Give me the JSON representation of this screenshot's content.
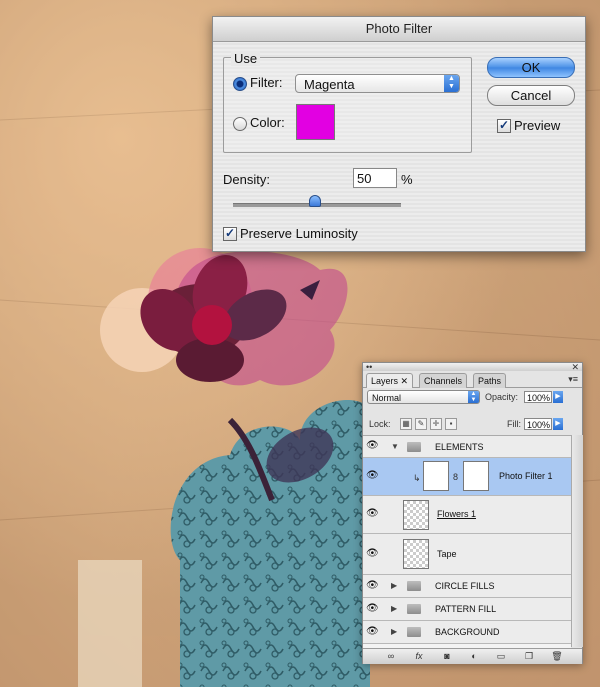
{
  "dialog": {
    "title": "Photo Filter",
    "use_group_label": "Use",
    "filter_label": "Filter:",
    "filter_value": "Magenta",
    "color_label": "Color:",
    "color_swatch": "#e200e2",
    "density_label": "Density:",
    "density_value": "50",
    "density_unit": "%",
    "density_level": 0.5,
    "preserve_luminosity_label": "Preserve Luminosity",
    "preserve_luminosity_checked": true,
    "ok_label": "OK",
    "cancel_label": "Cancel",
    "preview_label": "Preview",
    "preview_checked": true,
    "selected_mode": "filter"
  },
  "layers_panel": {
    "tabs": [
      {
        "label": "Layers",
        "close": "✕",
        "active": true
      },
      {
        "label": "Channels",
        "active": false
      },
      {
        "label": "Paths",
        "active": false
      }
    ],
    "blend_mode": "Normal",
    "opacity_label": "Opacity:",
    "opacity_value": "100%",
    "lock_label": "Lock:",
    "fill_label": "Fill:",
    "fill_value": "100%",
    "layers": [
      {
        "name": "ELEMENTS",
        "type": "group",
        "expanded": true
      },
      {
        "name": "Photo Filter 1",
        "type": "adjustment",
        "selected": true
      },
      {
        "name": "Flowers 1",
        "type": "layer"
      },
      {
        "name": "Tape",
        "type": "layer"
      },
      {
        "name": "CIRCLE FILLS",
        "type": "group",
        "expanded": false
      },
      {
        "name": "PATTERN FILL",
        "type": "group",
        "expanded": false
      },
      {
        "name": "BACKGROUND",
        "type": "group",
        "expanded": false
      }
    ],
    "bottom_icons": [
      "link-icon",
      "fx-icon",
      "mask-icon",
      "adjustment-icon",
      "folder-icon",
      "new-layer-icon",
      "trash-icon"
    ],
    "fx_label": "fx"
  },
  "colors": {
    "accent_blue": "#3e86e2",
    "selected_row": "#a9c8f2",
    "magenta": "#e200e2",
    "background_paper": "#c9a27a",
    "pattern_teal": "#5f9aa6"
  }
}
